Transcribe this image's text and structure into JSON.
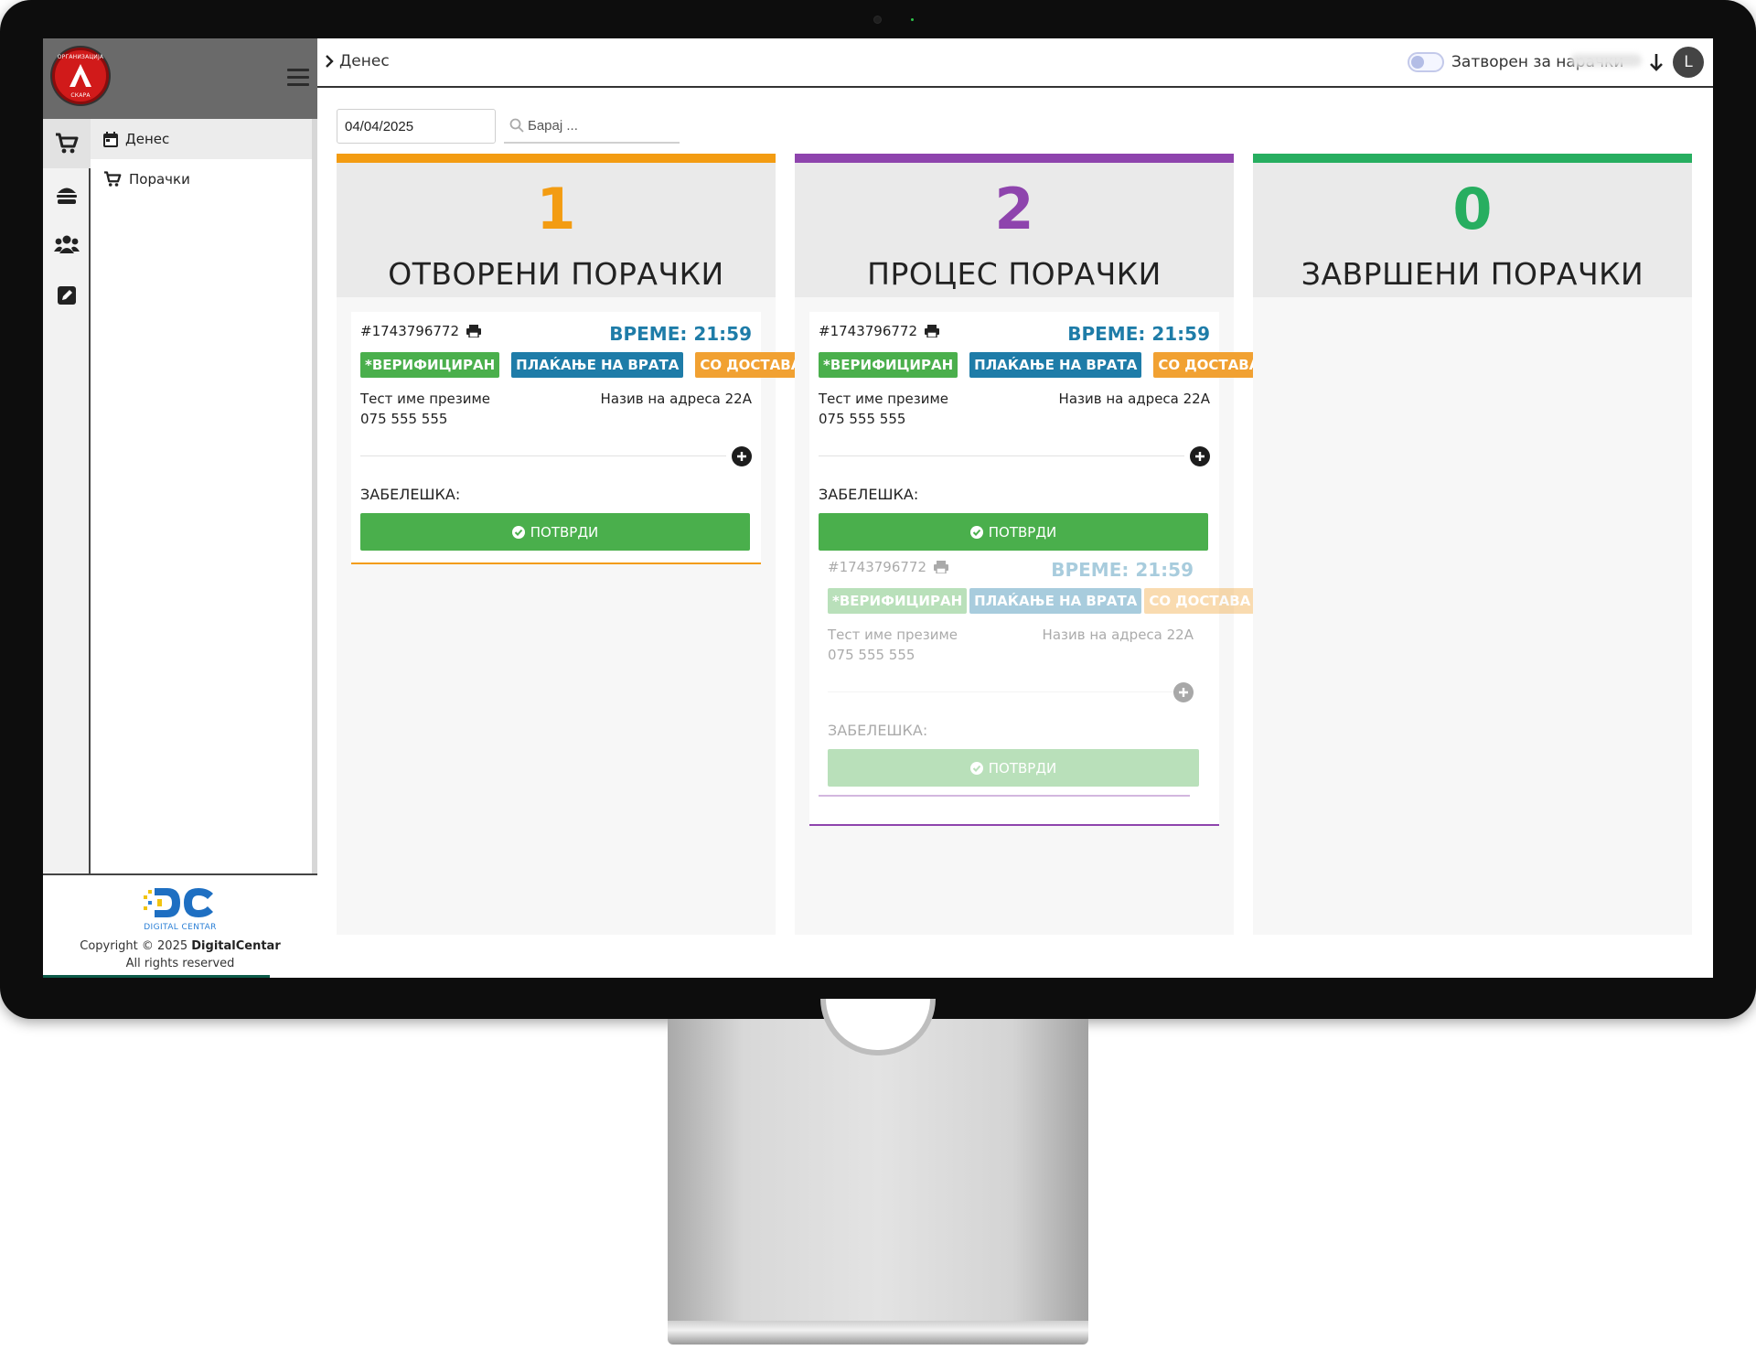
{
  "sidebar": {
    "logo_top_text": "ОРГАНИЗАЦИЈА",
    "logo_bottom_text": "СКАРА",
    "nav": [
      {
        "label": "Денес",
        "icon": "calendar-icon",
        "active": true
      },
      {
        "label": "Порачки",
        "icon": "cart-icon",
        "active": false
      }
    ],
    "rail_icons": [
      "cart-icon",
      "burger-icon",
      "users-icon",
      "edit-icon"
    ],
    "footer": {
      "dc_caption": "DIGITAL CENTAR",
      "copyright_prefix": "Copyright © 2025",
      "copyright_brand": "DigitalCentar",
      "rights": "All rights reserved"
    }
  },
  "topbar": {
    "breadcrumb": "Денес",
    "toggle_label": "Затворен за нарачки",
    "avatar_initial": "L"
  },
  "filters": {
    "date_value": "04/04/2025",
    "search_placeholder": "Барај ..."
  },
  "columns": [
    {
      "count": "1",
      "title": "ОТВОРЕНИ ПОРАЧКИ",
      "color": "#f39c12"
    },
    {
      "count": "2",
      "title": "ПРОЦЕС ПОРАЧКИ",
      "color": "#8e44ad"
    },
    {
      "count": "0",
      "title": "ЗАВРШЕНИ ПОРАЧКИ",
      "color": "#27ae60"
    }
  ],
  "orders": {
    "open": {
      "id": "#1743796772",
      "time": "ВРЕМЕ: 21:59",
      "badges": [
        "*ВЕРИФИЦИРАН",
        "ПЛАЌАЊЕ НА ВРАТА",
        "СО ДОСТАВА"
      ],
      "customer_name": "Тест име презиме",
      "phone": "075 555 555",
      "address": "Назив на адреса 22А",
      "note_label": "ЗАБЕЛЕШКА:",
      "confirm_label": "ПОТВРДИ"
    },
    "process_main": {
      "id": "#1743796772",
      "time": "ВРЕМЕ: 21:59",
      "badges": [
        "*ВЕРИФИЦИРАН",
        "ПЛАЌАЊЕ НА ВРАТА",
        "СО ДОСТАВА"
      ],
      "customer_name": "Тест име презиме",
      "phone": "075 555 555",
      "address": "Назив на адреса 22А",
      "note_label": "ЗАБЕЛЕШКА:",
      "confirm_label": "ПОТВРДИ"
    },
    "process_faded": {
      "id": "#1743796772",
      "time": "ВРЕМЕ: 21:59",
      "badges": [
        "*ВЕРИФИЦИРАН",
        "ПЛАЌАЊЕ НА ВРАТА",
        "СО ДОСТАВА"
      ],
      "customer_name": "Тест име презиме",
      "phone": "075 555 555",
      "address": "Назив на адреса 22А",
      "note_label": "ЗАБЕЛЕШКА:",
      "confirm_label": "ПОТВРДИ"
    }
  },
  "colors": {
    "verified": "#4aaf4c",
    "payment": "#1e7ca8",
    "delivery": "#f1a132",
    "time": "#1e7ca8"
  }
}
